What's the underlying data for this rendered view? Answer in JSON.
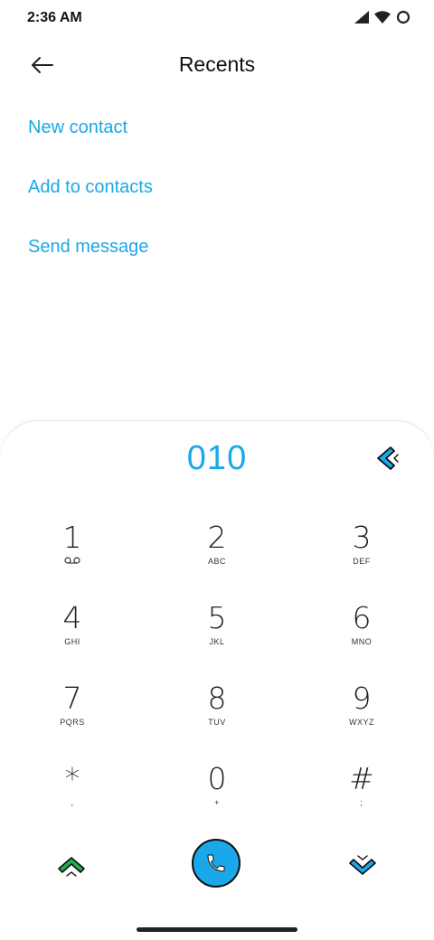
{
  "status_bar": {
    "time": "2:36 AM"
  },
  "header": {
    "title": "Recents"
  },
  "actions": [
    {
      "label": "New contact"
    },
    {
      "label": "Add to contacts"
    },
    {
      "label": "Send message"
    }
  ],
  "dialer": {
    "number": "010",
    "keys": [
      {
        "digit": "1",
        "letters": ""
      },
      {
        "digit": "2",
        "letters": "ABC"
      },
      {
        "digit": "3",
        "letters": "DEF"
      },
      {
        "digit": "4",
        "letters": "GHI"
      },
      {
        "digit": "5",
        "letters": "JKL"
      },
      {
        "digit": "6",
        "letters": "MNO"
      },
      {
        "digit": "7",
        "letters": "PQRS"
      },
      {
        "digit": "8",
        "letters": "TUV"
      },
      {
        "digit": "9",
        "letters": "WXYZ"
      },
      {
        "digit": "*",
        "letters": ","
      },
      {
        "digit": "0",
        "letters": "+"
      },
      {
        "digit": "#",
        "letters": ";"
      }
    ]
  },
  "colors": {
    "accent": "#1aa8e8",
    "expand_green": "#22b04b"
  },
  "icons": {
    "back": "back-arrow-icon",
    "backspace": "backspace-icon",
    "voicemail": "voicemail-icon",
    "call": "phone-icon",
    "expand": "chevron-up-icon",
    "collapse": "chevron-down-icon"
  }
}
